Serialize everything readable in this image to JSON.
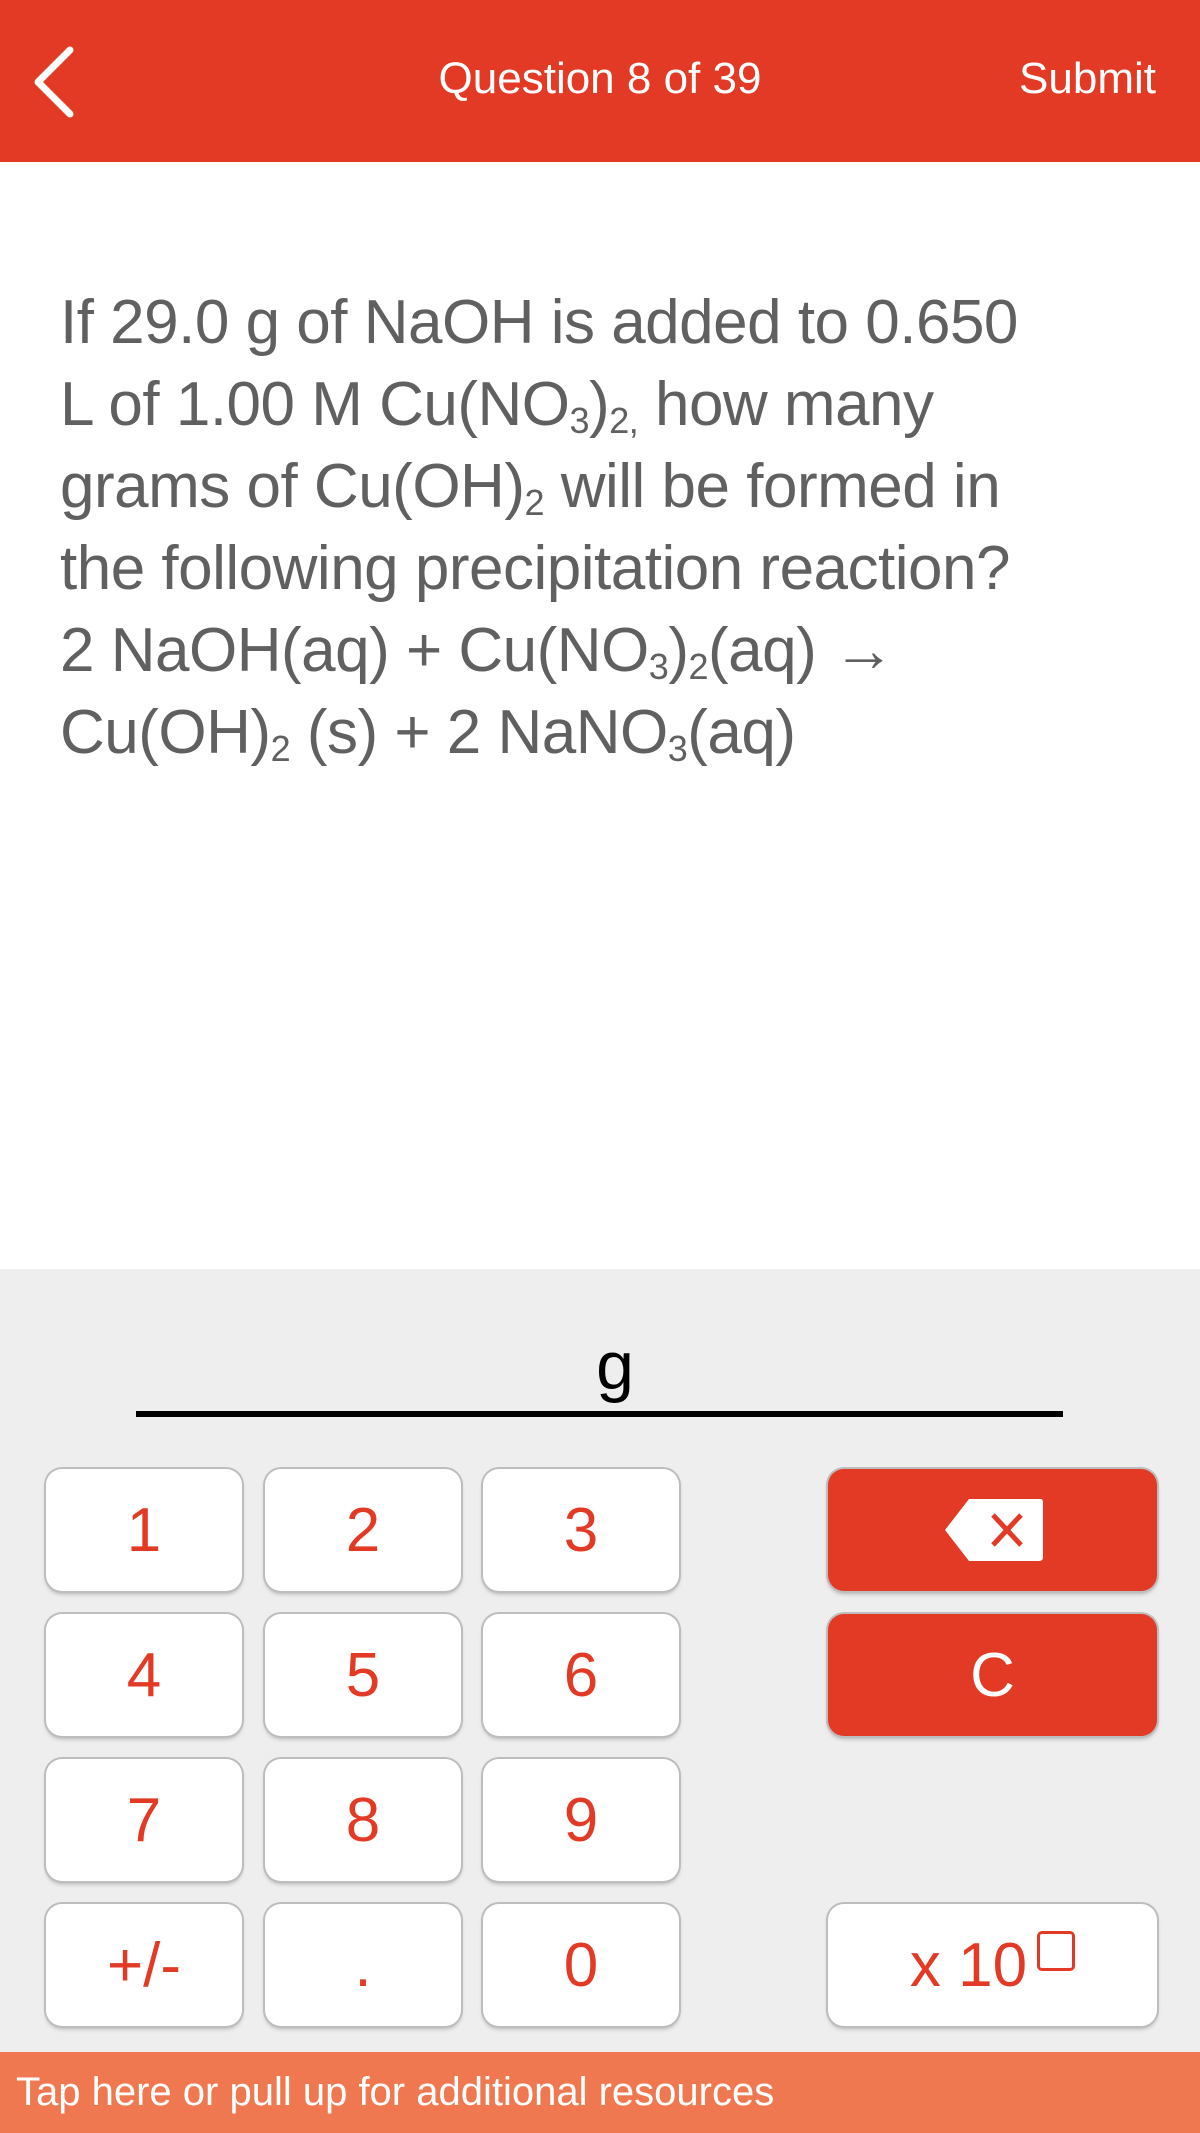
{
  "header": {
    "title": "Question 8 of 39",
    "submit_label": "Submit",
    "back_icon": "chevron-left-icon"
  },
  "question": {
    "line1": "If 29.0 g of NaOH is added to 0.650",
    "line2": {
      "a": "L of 1.00 M Cu(NO",
      "s1": "3",
      "b": ")",
      "s2": "2,",
      "c": " how many"
    },
    "line3": {
      "a": "grams of Cu(OH)",
      "s1": "2",
      "b": " will be formed in"
    },
    "line4": "the following precipitation reaction?",
    "line5": {
      "a": "2 NaOH(aq) + Cu(NO",
      "s1": "3",
      "b": ")",
      "s2": "2",
      "c": "(aq) →"
    },
    "line6": {
      "a": "Cu(OH)",
      "s1": "2",
      "b": " (s) + 2 NaNO",
      "s2": "3",
      "c": "(aq)"
    }
  },
  "answer": {
    "unit": "g",
    "value": ""
  },
  "keypad": {
    "k1": "1",
    "k2": "2",
    "k3": "3",
    "k4": "4",
    "k5": "5",
    "k6": "6",
    "k7": "7",
    "k8": "8",
    "k9": "9",
    "sign": "+/-",
    "decimal": ".",
    "k0": "0",
    "clear": "C",
    "exponent": "x 10",
    "backspace_icon": "backspace-icon"
  },
  "footer": {
    "text": "Tap here or pull up for additional resources"
  },
  "colors": {
    "accent": "#e33a26",
    "footer": "#f07850",
    "keypad_bg": "#eeeeee",
    "question_text": "#606060"
  }
}
